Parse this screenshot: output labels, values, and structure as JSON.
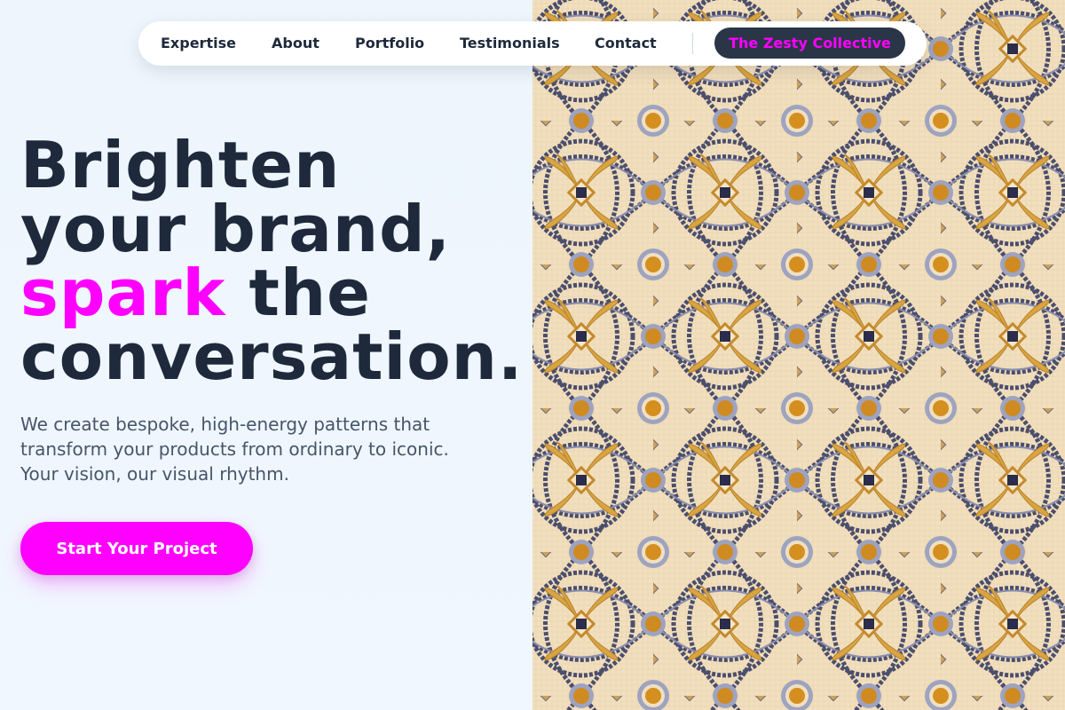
{
  "nav": {
    "links": [
      {
        "label": "Expertise"
      },
      {
        "label": "About"
      },
      {
        "label": "Portfolio"
      },
      {
        "label": "Testimonials"
      },
      {
        "label": "Contact"
      }
    ],
    "cta_label": "The Zesty Collective"
  },
  "hero": {
    "headline_line1": "Brighten",
    "headline_line2": "your brand,",
    "headline_accent": "spark",
    "headline_line3_rest": " the",
    "headline_line4": "conversation.",
    "subtext": "We create bespoke, high-energy patterns that transform your products from ordinary to iconic. Your vision, our visual rhythm.",
    "cta_label": "Start Your Project"
  },
  "colors": {
    "accent": "#ff00ff",
    "text_dark": "#1e293b",
    "text_muted": "#475569",
    "background": "#eef5fd",
    "nav_cta_bg": "#2a3647"
  },
  "image": {
    "subject": "mosaic-tile-pattern"
  }
}
